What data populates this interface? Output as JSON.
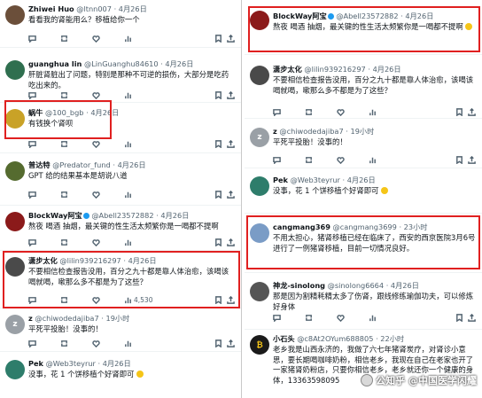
{
  "left": {
    "tweets": [
      {
        "name": "Zhiwei Huo",
        "handle": "@ltnn007",
        "time": "4月26日",
        "text": "看看我的肾能用么？移植给你一个",
        "replies": "",
        "retweets": "",
        "likes": "",
        "views": "",
        "avatar_color": "#6b4f3a"
      },
      {
        "name": "guanghua lin",
        "handle": "@LinGuanghu84610",
        "time": "4月26日",
        "text": "肝脏肾脏出了问题，特别是那种不可逆的损伤，大部分是吃药吃出来的。",
        "replies": "",
        "retweets": "",
        "likes": "",
        "views": "",
        "avatar_color": "#2f6f4f"
      },
      {
        "name": "蜗牛",
        "handle": "@100_bgb",
        "time": "4月26日",
        "text": "有钱换个肾呗",
        "replies": "",
        "retweets": "",
        "likes": "",
        "views": "",
        "avatar_color": "#c9a227"
      },
      {
        "name": "普达特",
        "handle": "@Predator_fund",
        "time": "4月26日",
        "text": "GPT 给的结果基本是胡说八道",
        "replies": "",
        "retweets": "",
        "likes": "",
        "views": "",
        "avatar_color": "#556b2f"
      },
      {
        "name": "BlockWay阿宝",
        "handle": "@Abell23572882",
        "time": "4月26日",
        "text": "熬夜 喝酒 抽烟，最关键的性生活太频繁你是一喝都不提啊",
        "replies": "",
        "retweets": "",
        "likes": "",
        "views": "",
        "avatar_color": "#8b1a1a"
      },
      {
        "name": "潇步太化",
        "handle": "@lilin939216297",
        "time": "4月26日",
        "text": "不要相信检查报告没用，百分之九十都是靠人体治愈，该喝该喝就喝，嗽那么多不都是为了这些？",
        "replies": "",
        "retweets": "",
        "likes": "",
        "views": "4,530",
        "avatar_color": "#4a4a4a"
      },
      {
        "name": "z",
        "handle": "@chiwodedajiba7",
        "time": "19小时",
        "text": "平死平投胎！没事的！",
        "replies": "",
        "retweets": "",
        "likes": "",
        "views": "",
        "avatar_color": "#9aa0a6"
      },
      {
        "name": "Pek",
        "handle": "@Web3teyrur",
        "time": "4月26日",
        "text": "没事，花 1 个饼移植个好肾即可",
        "replies": "",
        "retweets": "",
        "likes": "",
        "views": "",
        "avatar_color": "#2e7d6b"
      }
    ]
  },
  "right": {
    "tweets": [
      {
        "name": "BlockWay阿宝",
        "handle": "@Abell23572882",
        "time": "4月26日",
        "text": "熬夜 喝酒 抽烟，最关键的性生活太频繁你是一喝都不提啊",
        "replies": "",
        "retweets": "",
        "likes": "",
        "views": "",
        "avatar_color": "#8b1a1a"
      },
      {
        "name": "潇步太化",
        "handle": "@lilin939216297",
        "time": "4月26日",
        "text": "不要相信检查报告没用，百分之九十都是靠人体治愈，该喝该喝就喝，嗽那么多不都是为了这些？",
        "replies": "",
        "retweets": "",
        "likes": "",
        "views": "",
        "avatar_color": "#4a4a4a"
      },
      {
        "name": "z",
        "handle": "@chiwodedajiba7",
        "time": "19小时",
        "text": "平死平投胎！没事的！",
        "replies": "",
        "retweets": "",
        "likes": "",
        "views": "",
        "avatar_color": "#9aa0a6"
      },
      {
        "name": "Pek",
        "handle": "@Web3teyrur",
        "time": "4月26日",
        "text": "没事，花 1 个饼移植个好肾即可",
        "replies": "",
        "retweets": "",
        "likes": "",
        "views": "",
        "avatar_color": "#2e7d6b"
      },
      {
        "name": "cangmang369",
        "handle": "@cangmang3699",
        "time": "23小时",
        "text": "不用太担心，猪肾移植已经在临床了，西安的西京医院3月6号进行了一例猪肾移植，目前一切情况良好。",
        "replies": "",
        "retweets": "",
        "likes": "",
        "views": "",
        "avatar_color": "#7a9cc6"
      },
      {
        "name": "神龙-sinolong",
        "handle": "@sinolong6664",
        "time": "4月26日",
        "text": "那是因为割精耗精太多了伤肾，跟线修练瑜伽功夫，可以修炼好身体",
        "replies": "",
        "retweets": "",
        "likes": "",
        "views": "",
        "avatar_color": "#555555"
      },
      {
        "name": "小石头",
        "handle": "@c8At2OYum688805",
        "time": "22小时",
        "text": "老乡我是山西永济的，我做了六七年猪肾炭疗，对肾诊小意思，要长期喝咖啡奶粉，相信老乡，我现在自己在老家也开了一家猪肾奶粉店，只要你相信老乡，老乡就还你一个健康的身体，13363598095",
        "replies": "",
        "retweets": "",
        "likes": "",
        "views": "",
        "avatar_color": "#1a1a1a"
      }
    ]
  },
  "watermark": {
    "text": "公知乎 @中国医学闪耀"
  },
  "colors": {
    "highlight_box": "#e02020",
    "meta_text": "#536471",
    "accent": "#1d9bf0"
  },
  "icons": {
    "reply": "reply-icon",
    "retweet": "retweet-icon",
    "like": "heart-icon",
    "views": "views-icon",
    "bookmark": "bookmark-icon",
    "share": "share-icon"
  }
}
